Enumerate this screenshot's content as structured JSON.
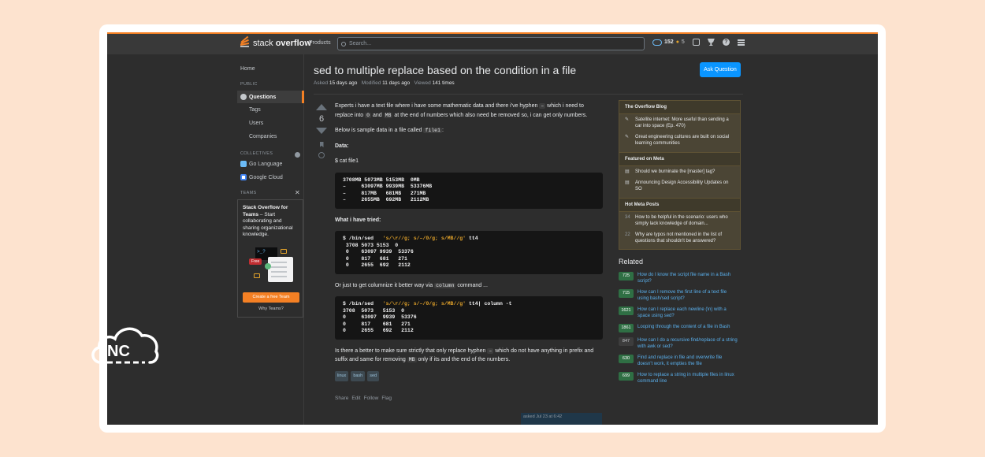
{
  "header": {
    "logo_light": "stack",
    "logo_bold": "overflow",
    "products": "Products",
    "search_placeholder": "Search...",
    "reputation": "152",
    "bronze_badges": "5"
  },
  "leftnav": {
    "home": "Home",
    "public": "PUBLIC",
    "questions": "Questions",
    "tags": "Tags",
    "users": "Users",
    "companies": "Companies",
    "collectives": "COLLECTIVES",
    "collective_items": [
      "Go Language",
      "Google Cloud"
    ],
    "teams": "TEAMS",
    "teams_title_bold": "Stack Overflow for Teams",
    "teams_title_rest": " – Start collaborating and sharing organizational knowledge.",
    "free": "Free",
    "terminal": ">_?",
    "create_button": "Create a free Team",
    "why_teams": "Why Teams?"
  },
  "question": {
    "title": "sed to multiple replace based on the condition in a file",
    "ask_button": "Ask Question",
    "asked_label": "Asked",
    "asked_value": "15 days ago",
    "modified_label": "Modified",
    "modified_value": "11 days ago",
    "viewed_label": "Viewed",
    "viewed_value": "141 times",
    "score": "6",
    "p1_a": "Experts i have a text file where i have some mathematic data and there i've hyphen ",
    "p1_code1": "–",
    "p1_b": " which i need to replace into ",
    "p1_code2": "0",
    "p1_c": " and ",
    "p1_code3": "MB",
    "p1_d": " at the end of numbers which also need be removed so, i can get only numbers.",
    "p2_a": "Below is sample data in a file called ",
    "p2_code": "file1",
    "p2_b": ":",
    "data_label": "Data:",
    "cat_line": "$ cat file1",
    "code1": "3708MB 5073MB 5153MB  0MB\n–     63097MB 9939MB  53376MB\n–     817MB   681MB   271MB\n–     2655MB  692MB   2112MB",
    "tried_label": "What i have tried:",
    "code2_cmd": "$ /bin/sed",
    "code2_str": "'s/\\r//g; s/–/0/g; s/MB//g'",
    "code2_tail": "tt4",
    "code2_out": " 3708 5073 5153  0\n 0    63097 9939  53376\n 0    817   681   271\n 0    2655  692   2112",
    "p3_a": "Or just to get columnize it better way via ",
    "p3_code": "column",
    "p3_b": " command ...",
    "code3_cmd": "$ /bin/sed",
    "code3_str": "'s/\\r//g; s/–/0/g; s/MB//g'",
    "code3_tail": "tt4| column -t",
    "code3_out": "3708  5073   5153  0\n0     63097  9939  53376\n0     817    681   271\n0     2655   692   2112",
    "p4_a": "Is there a better to make sure strictly that only replace hyphen ",
    "p4_code1": "–",
    "p4_b": " which do not have anything in prefix and suffix and same for removing ",
    "p4_code2": "MB",
    "p4_c": " only if its and the end of the numbers.",
    "tags": [
      "linux",
      "bash",
      "sed"
    ],
    "share": "Share",
    "edit": "Edit",
    "follow": "Follow",
    "flag": "Flag",
    "asked_card": "asked Jul 23 at 6:42"
  },
  "sidebar": {
    "blog_header": "The Overflow Blog",
    "blog_items": [
      "Satellite internet: More useful than sending a car into space (Ep. 470)",
      "Great engineering cultures are built on social learning communities"
    ],
    "meta_header": "Featured on Meta",
    "meta_items": [
      "Should we burninate the [master] tag?",
      "Announcing Design Accessibility Updates on SO"
    ],
    "hot_header": "Hot Meta Posts",
    "hot_items": [
      {
        "num": "34",
        "text": "How to be helpful in the scenario: users who simply lack knowledge of domain..."
      },
      {
        "num": "22",
        "text": "Why are typos not mentioned in the list of questions that shouldn't be answered?"
      }
    ],
    "related_header": "Related",
    "related": [
      {
        "count": "725",
        "text": "How do I know the script file name in a Bash script?"
      },
      {
        "count": "715",
        "text": "How can I remove the first line of a text file using bash/sed script?"
      },
      {
        "count": "1621",
        "text": "How can I replace each newline (\\n) with a space using sed?"
      },
      {
        "count": "1861",
        "text": "Looping through the content of a file in Bash"
      },
      {
        "count": "847",
        "text": "How can I do a recursive find/replace of a string with awk or sed?"
      },
      {
        "count": "630",
        "text": "Find and replace in file and overwrite file doesn't work, it empties the file"
      },
      {
        "count": "699",
        "text": "How to replace a string in multiple files in linux command line"
      }
    ]
  },
  "watermark": {
    "text": "NC"
  },
  "colors": {
    "accent": "#f48024",
    "link": "#5ab0ed",
    "button": "#0a95ff",
    "background": "#fde3cf"
  }
}
